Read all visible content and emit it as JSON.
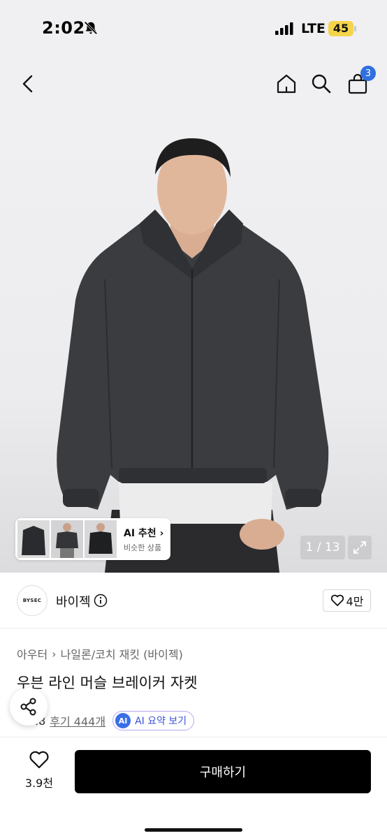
{
  "status_bar": {
    "time": "2:02",
    "network": "LTE",
    "battery": "45",
    "battery_color": "#f6d44a"
  },
  "nav": {
    "back_icon": "chevron-left-icon",
    "home_icon": "home-icon",
    "search_icon": "search-icon",
    "cart_icon": "cart-icon",
    "cart_badge": "3",
    "badge_color": "#2f6fe0"
  },
  "gallery": {
    "ai_recommend_title": "AI 추천",
    "ai_recommend_subtitle": "비슷한 상품",
    "page_counter": "1 / 13"
  },
  "brand": {
    "logo_text": "BYSEC",
    "name": "바이젝",
    "like_count": "4만"
  },
  "product": {
    "category": [
      "아우터",
      "나일론/코치 재킷 (바이젝)"
    ],
    "title": "우븐 라인 머슬 브레이커 자켓",
    "rating": ".8",
    "review_link": "후기 444개",
    "ai_badge": "AI",
    "ai_summary_label": "AI 요약 보기"
  },
  "bottom_bar": {
    "wish_count": "3.9천",
    "buy_label": "구매하기"
  }
}
